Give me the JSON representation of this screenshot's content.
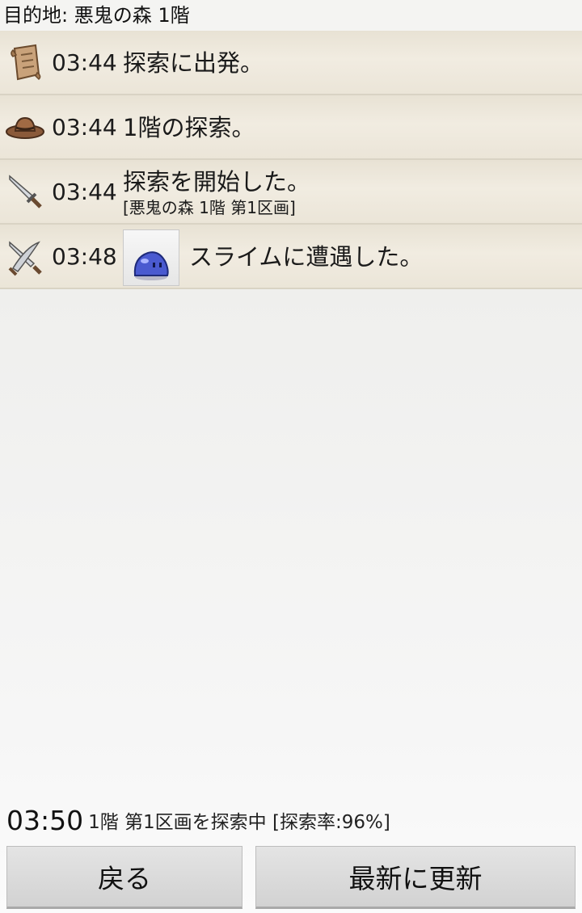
{
  "destination": "目的地: 悪鬼の森 1階",
  "log": [
    {
      "icon": "scroll-icon",
      "time": "03:44",
      "message": "探索に出発。"
    },
    {
      "icon": "hat-icon",
      "time": "03:44",
      "message": "1階の探索。"
    },
    {
      "icon": "sword-icon",
      "time": "03:44",
      "message": "探索を開始した。",
      "sub": "[悪鬼の森 1階 第1区画]"
    },
    {
      "icon": "crossed-swords-icon",
      "time": "03:48",
      "enemy_icon": "slime-icon",
      "message": "スライムに遭遇した。"
    }
  ],
  "status": {
    "time": "03:50",
    "text": "1階 第1区画を探索中 [探索率:96%]"
  },
  "buttons": {
    "back": "戻る",
    "refresh": "最新に更新"
  }
}
